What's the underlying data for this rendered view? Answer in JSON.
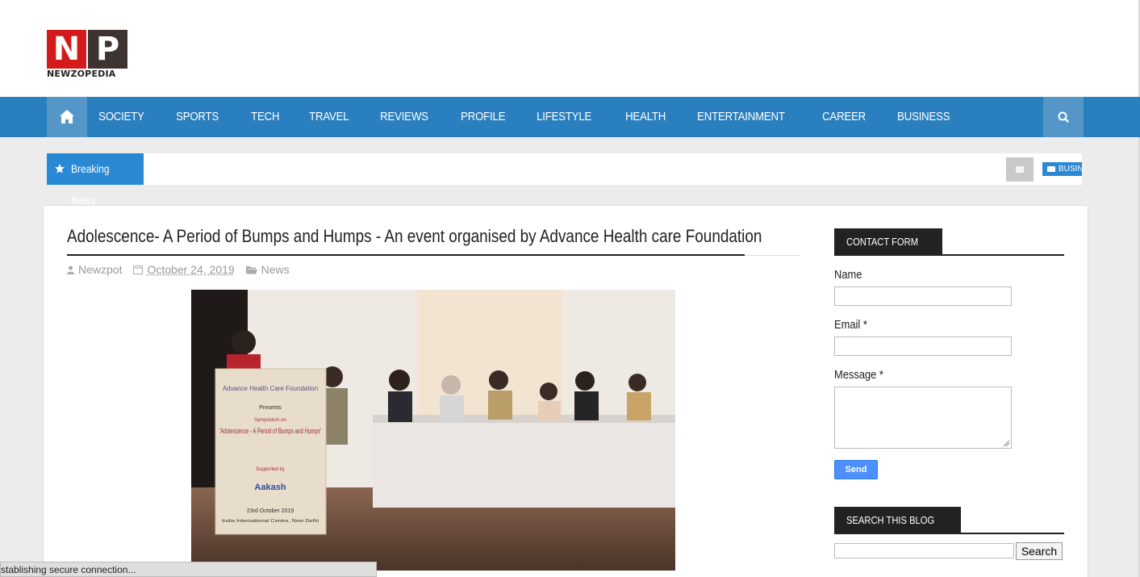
{
  "logo": {
    "letter_n": "N",
    "letter_p": "P",
    "wordmark": "NEWZOPEDIA"
  },
  "nav": {
    "items": [
      "SOCIETY",
      "SPORTS",
      "TECH",
      "TRAVEL",
      "REVIEWS",
      "PROFILE",
      "LIFESTYLE",
      "HEALTH",
      "ENTERTAINMENT",
      "CAREER",
      "BUSINESS"
    ],
    "home_icon": "home-icon",
    "search_icon": "search-icon"
  },
  "ticker": {
    "label": "Breaking News",
    "tag": "BUSINESS"
  },
  "article": {
    "title": "Adolescence- A Period of Bumps and Humps - An event organised by Advance Health care Foundation",
    "author": "Newzpot",
    "date": "October 24, 2019",
    "category": "News",
    "banner": {
      "org": "Advance Health Care Foundation",
      "presents": "Presents",
      "symposium": "Symposium on",
      "headline": "'Adolescence - A Period of Bumps and Humps'",
      "supported": "Supported by",
      "sponsor": "Aakash",
      "date": "23rd October 2019",
      "venue": "India International Centre, New Delhi"
    }
  },
  "sidebar": {
    "contact_title": "CONTACT FORM",
    "name_label": "Name",
    "email_label": "Email *",
    "message_label": "Message *",
    "send_label": "Send",
    "search_title": "SEARCH THIS BLOG",
    "search_button": "Search"
  },
  "status": {
    "text": "stablishing secure connection..."
  },
  "colors": {
    "nav": "#2a7fbe",
    "nav_active": "#5596c8",
    "ticker": "#2a89d4",
    "logo_red": "#d31b1b",
    "logo_dark": "#3d3330",
    "send": "#4d90fe"
  }
}
